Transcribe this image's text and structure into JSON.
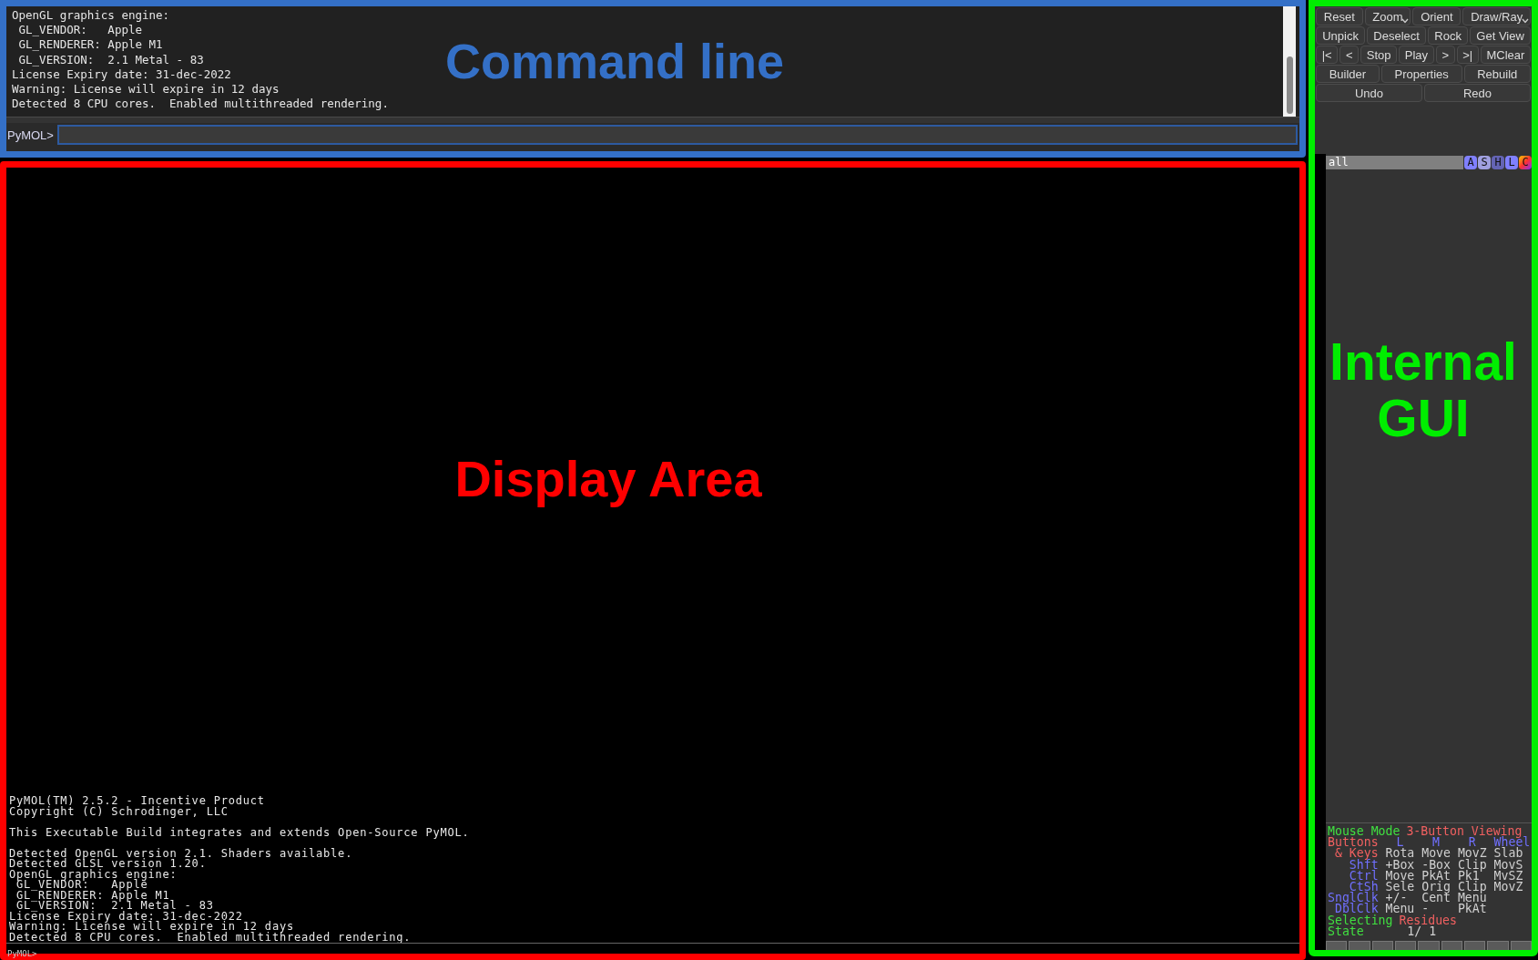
{
  "annotations": [
    {
      "label": "Command line",
      "color": "#3470c7"
    },
    {
      "label": "Display Area",
      "color": "#ff0000"
    },
    {
      "label": "Internal GUI",
      "color": "#00ee00"
    }
  ],
  "command_line": {
    "log": [
      "OpenGL graphics engine:",
      " GL_VENDOR:   Apple",
      " GL_RENDERER: Apple M1",
      " GL_VERSION:  2.1 Metal - 83",
      "License Expiry date: 31-dec-2022",
      "Warning: License will expire in 12 days",
      "Detected 8 CPU cores.  Enabled multithreaded rendering."
    ],
    "prompt": "PyMOL>"
  },
  "display_area": {
    "log": [
      [
        "PyMOL(TM) 2.5.2 - Incentive Product",
        "Copyright (C) Schrodinger, LLC"
      ],
      [
        "This Executable Build integrates and extends Open-Source PyMOL."
      ],
      [
        "Detected OpenGL version 2.1. Shaders available.",
        "Detected GLSL version 1.20.",
        "OpenGL graphics engine:",
        " GL_VENDOR:   Apple",
        " GL_RENDERER: Apple M1",
        " GL_VERSION:  2.1 Metal - 83",
        "License Expiry date: 31-dec-2022",
        "Warning: License will expire in 12 days",
        "Detected 8 CPU cores.  Enabled multithreaded rendering."
      ]
    ],
    "prompt": "PyMOL>"
  },
  "internal_gui": {
    "button_rows": [
      [
        {
          "label": "Reset",
          "dropdown": false
        },
        {
          "label": "Zoom",
          "dropdown": true
        },
        {
          "label": "Orient",
          "dropdown": false
        },
        {
          "label": "Draw/Ray",
          "dropdown": true
        }
      ],
      [
        {
          "label": "Unpick",
          "dropdown": false
        },
        {
          "label": "Deselect",
          "dropdown": false
        },
        {
          "label": "Rock",
          "dropdown": false
        },
        {
          "label": "Get View",
          "dropdown": false
        }
      ],
      [
        {
          "label": "|<",
          "dropdown": false
        },
        {
          "label": "<",
          "dropdown": false
        },
        {
          "label": "Stop",
          "dropdown": false
        },
        {
          "label": "Play",
          "dropdown": false
        },
        {
          "label": ">",
          "dropdown": false
        },
        {
          "label": ">|",
          "dropdown": false
        },
        {
          "label": "MClear",
          "dropdown": false
        }
      ],
      [
        {
          "label": "Builder",
          "dropdown": false
        },
        {
          "label": "Properties",
          "dropdown": false
        },
        {
          "label": "Rebuild",
          "dropdown": false
        }
      ],
      [
        {
          "label": "Undo",
          "dropdown": false
        },
        {
          "label": "Redo",
          "dropdown": false
        }
      ]
    ],
    "object": {
      "name": "all",
      "buttons": [
        {
          "label": "A",
          "kind": "solid",
          "color": "#8080ff"
        },
        {
          "label": "S",
          "kind": "solid",
          "color": "#a0a0e0"
        },
        {
          "label": "H",
          "kind": "solid",
          "color": "#6464b4"
        },
        {
          "label": "L",
          "kind": "solid",
          "color": "#8080ff"
        },
        {
          "label": "C",
          "kind": "rainbow"
        }
      ]
    },
    "mouse_mode": [
      {
        "kind": "flow",
        "cells": [
          {
            "text": "Mouse Mode",
            "kind": "status"
          },
          {
            "text": "3-Button Viewing",
            "kind": "mode"
          }
        ]
      },
      {
        "kind": "header",
        "cells": [
          {
            "text": "Buttons",
            "kind": "mode"
          },
          {
            "text": "L",
            "kind": "button"
          },
          {
            "text": "M",
            "kind": "button"
          },
          {
            "text": "R",
            "kind": "button"
          },
          {
            "text": "Wheel",
            "kind": "button"
          }
        ]
      },
      {
        "kind": "grid",
        "cells": [
          {
            "text": "& Keys",
            "kind": "mode"
          },
          {
            "text": "Rota",
            "kind": "action"
          },
          {
            "text": "Move",
            "kind": "action"
          },
          {
            "text": "MovZ",
            "kind": "action"
          },
          {
            "text": "Slab",
            "kind": "action"
          }
        ]
      },
      {
        "kind": "grid",
        "cells": [
          {
            "text": "Shft",
            "kind": "button"
          },
          {
            "text": "+Box",
            "kind": "action"
          },
          {
            "text": "-Box",
            "kind": "action"
          },
          {
            "text": "Clip",
            "kind": "action"
          },
          {
            "text": "MovS",
            "kind": "action"
          }
        ]
      },
      {
        "kind": "grid",
        "cells": [
          {
            "text": "Ctrl",
            "kind": "button"
          },
          {
            "text": "Move",
            "kind": "action"
          },
          {
            "text": "PkAt",
            "kind": "action"
          },
          {
            "text": "Pk1",
            "kind": "action"
          },
          {
            "text": "MvSZ",
            "kind": "action"
          }
        ]
      },
      {
        "kind": "grid",
        "cells": [
          {
            "text": "CtSh",
            "kind": "button"
          },
          {
            "text": "Sele",
            "kind": "action"
          },
          {
            "text": "Orig",
            "kind": "action"
          },
          {
            "text": "Clip",
            "kind": "action"
          },
          {
            "text": "MovZ",
            "kind": "action"
          }
        ]
      },
      {
        "kind": "grid",
        "cells": [
          {
            "text": "SnglClk",
            "kind": "button"
          },
          {
            "text": "+/-",
            "kind": "action"
          },
          {
            "text": "Cent",
            "kind": "action"
          },
          {
            "text": "Menu",
            "kind": "action"
          }
        ]
      },
      {
        "kind": "grid",
        "cells": [
          {
            "text": "DblClk",
            "kind": "button"
          },
          {
            "text": "Menu",
            "kind": "action"
          },
          {
            "text": "-",
            "kind": "action"
          },
          {
            "text": "PkAt",
            "kind": "action"
          }
        ]
      },
      {
        "kind": "flow",
        "cells": [
          {
            "text": "Selecting",
            "kind": "status"
          },
          {
            "text": "Residues",
            "kind": "mode"
          }
        ]
      },
      {
        "kind": "state",
        "cells": [
          {
            "text": "State",
            "kind": "status"
          },
          {
            "text": "1/",
            "kind": "action"
          },
          {
            "text": "1",
            "kind": "action"
          }
        ]
      }
    ]
  }
}
